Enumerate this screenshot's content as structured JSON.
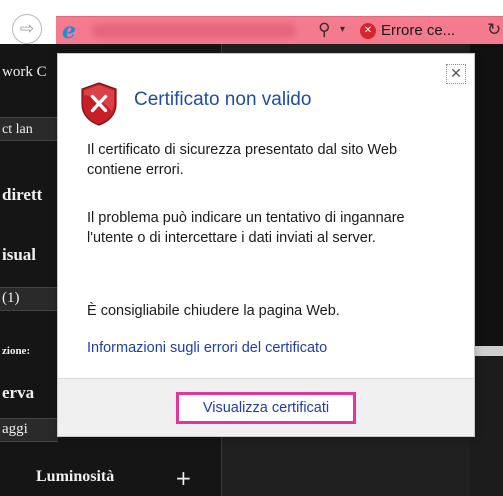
{
  "address_bar": {
    "forward_glyph": "⇨",
    "browser_icon_glyph": "e",
    "search_glyph": "⚲",
    "dropdown_glyph": "▾",
    "cert_error_glyph": "✕",
    "cert_error_label": "Errore ce...",
    "refresh_glyph": "↻",
    "url_color": "#f47a8e"
  },
  "background_page": {
    "items": [
      "work C",
      "ct lan",
      "dirett",
      "isual",
      "(1)",
      "zione:",
      "erva",
      "aggi",
      "Luminosità"
    ],
    "plus_label": "+"
  },
  "popup": {
    "close_glyph": "✕",
    "title": "Certificato non valido",
    "paragraph_1": "Il certificato di sicurezza presentato dal sito Web contiene errori.",
    "paragraph_2": "Il problema può indicare un tentativo di ingannare l'utente o di intercettare i dati inviati al server.",
    "paragraph_3": "È consigliabile chiudere la pagina Web.",
    "info_link": "Informazioni sugli errori del certificato",
    "view_certificates_button": "Visualizza certificati",
    "title_color": "#1f4ea0",
    "highlight_color": "#e2359e"
  }
}
